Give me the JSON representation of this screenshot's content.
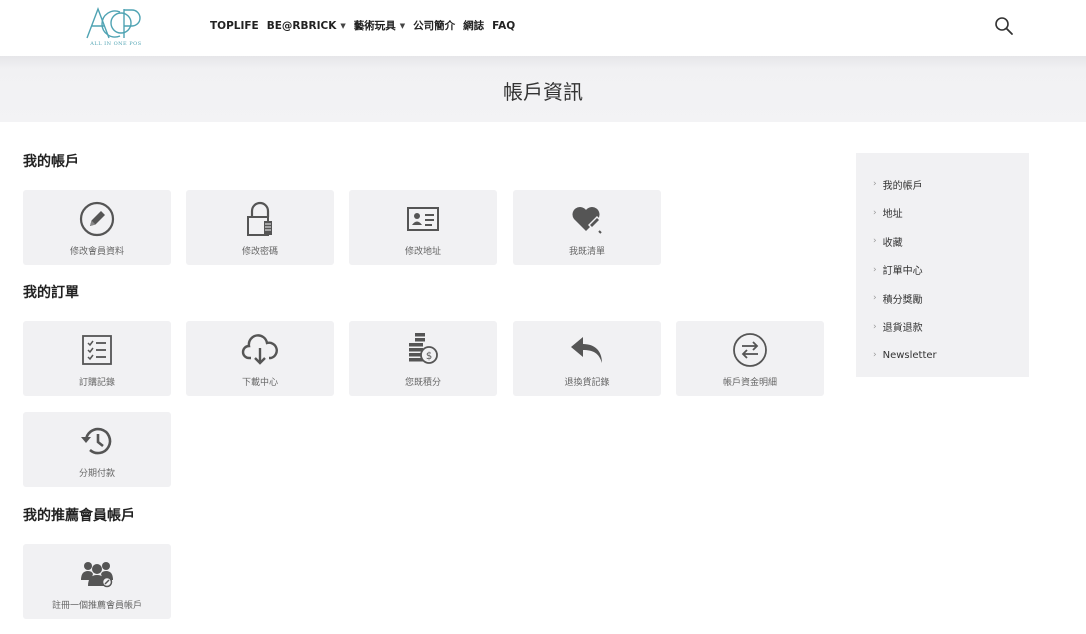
{
  "header": {
    "logo_text": "ALL IN ONE POS",
    "logo_mark": "AIOP",
    "nav": [
      {
        "label": "TOPLIFE",
        "dropdown": false
      },
      {
        "label": "BE@RBRICK",
        "dropdown": true
      },
      {
        "label": "藝術玩具",
        "dropdown": true
      },
      {
        "label": "公司簡介",
        "dropdown": false
      },
      {
        "label": "網誌",
        "dropdown": false
      },
      {
        "label": "FAQ",
        "dropdown": false
      }
    ],
    "search_icon": "search-icon"
  },
  "banner": {
    "title": "帳戶資訊"
  },
  "sections": {
    "account": {
      "title": "我的帳戶",
      "tiles": [
        {
          "label": "修改會員資料",
          "icon": "pencil-circle-icon"
        },
        {
          "label": "修改密碼",
          "icon": "lock-icon"
        },
        {
          "label": "修改地址",
          "icon": "address-card-icon"
        },
        {
          "label": "我既清單",
          "icon": "heart-pencil-icon"
        }
      ]
    },
    "orders": {
      "title": "我的訂單",
      "tiles": [
        {
          "label": "訂購記錄",
          "icon": "checklist-icon"
        },
        {
          "label": "下載中心",
          "icon": "cloud-download-icon"
        },
        {
          "label": "您既積分",
          "icon": "coins-stack-icon"
        },
        {
          "label": "退換貨記錄",
          "icon": "reply-arrow-icon"
        },
        {
          "label": "帳戶資金明細",
          "icon": "exchange-circle-icon"
        },
        {
          "label": "分期付款",
          "icon": "history-icon"
        }
      ]
    },
    "referral": {
      "title": "我的推薦會員帳戶",
      "tiles": [
        {
          "label": "註冊一個推薦會員帳戶",
          "icon": "users-icon"
        }
      ]
    }
  },
  "sidebar": {
    "items": [
      {
        "label": "我的帳戶"
      },
      {
        "label": "地址"
      },
      {
        "label": "收藏"
      },
      {
        "label": "訂單中心"
      },
      {
        "label": "積分獎勵"
      },
      {
        "label": "退貨退款"
      },
      {
        "label": "Newsletter"
      }
    ],
    "chevron": "›"
  },
  "colors": {
    "tile_bg": "#f1f1f3",
    "icon": "#555555",
    "logo": "#4fa3b3"
  }
}
